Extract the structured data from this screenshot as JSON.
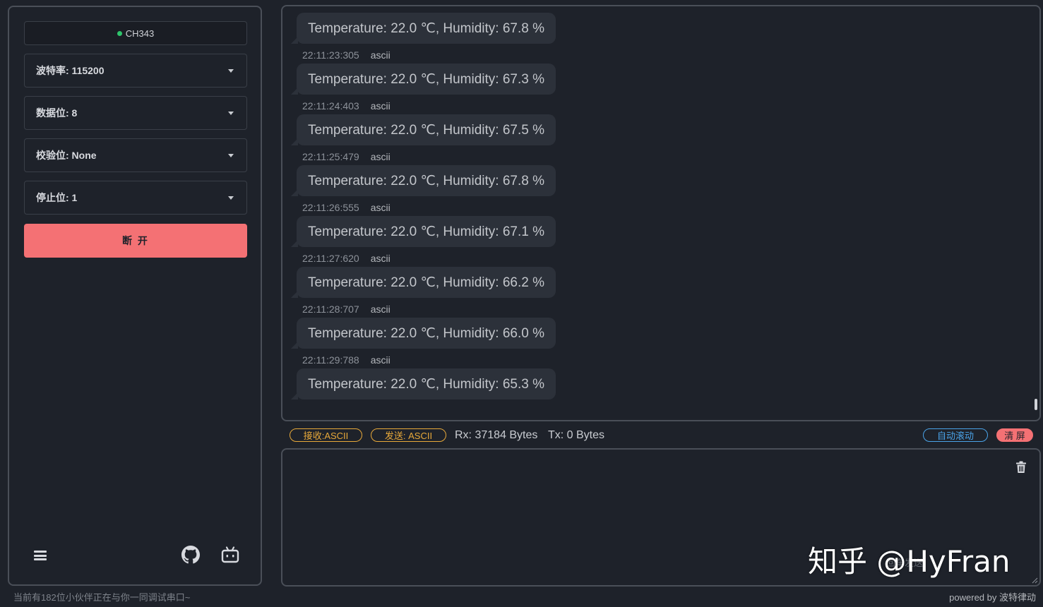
{
  "sidebar": {
    "port_name": "CH343",
    "port_status_color": "#2ec46b",
    "baud_rate_label": "波特率: 115200",
    "data_bits_label": "数据位: 8",
    "parity_label": "校验位: None",
    "stop_bits_label": "停止位: 1",
    "disconnect_label": "断 开",
    "icons": [
      "menu-icon",
      "github-icon",
      "bilibili-icon"
    ]
  },
  "messages": [
    {
      "time": "",
      "format": "",
      "text": "Temperature: 22.0 ℃, Humidity: 67.8 %"
    },
    {
      "time": "22:11:23:305",
      "format": "ascii",
      "text": "Temperature: 22.0 ℃, Humidity: 67.3 %"
    },
    {
      "time": "22:11:24:403",
      "format": "ascii",
      "text": "Temperature: 22.0 ℃, Humidity: 67.5 %"
    },
    {
      "time": "22:11:25:479",
      "format": "ascii",
      "text": "Temperature: 22.0 ℃, Humidity: 67.8 %"
    },
    {
      "time": "22:11:26:555",
      "format": "ascii",
      "text": "Temperature: 22.0 ℃, Humidity: 67.1 %"
    },
    {
      "time": "22:11:27:620",
      "format": "ascii",
      "text": "Temperature: 22.0 ℃, Humidity: 66.2 %"
    },
    {
      "time": "22:11:28:707",
      "format": "ascii",
      "text": "Temperature: 22.0 ℃, Humidity: 66.0 %"
    },
    {
      "time": "22:11:29:788",
      "format": "ascii",
      "text": "Temperature: 22.0 ℃, Humidity: 65.3 %"
    }
  ],
  "status": {
    "recv_mode": "接收:ASCII",
    "send_mode": "发送: ASCII",
    "rx": "Rx: 37184 Bytes",
    "tx": "Tx: 0 Bytes",
    "auto_scroll": "自动滚动",
    "clear": "清 屏"
  },
  "send": {
    "hint": "回车发送"
  },
  "watermark": "知乎 @HyFran",
  "footer": {
    "online": "当前有182位小伙伴正在与你一同调试串口~",
    "powered": "powered by 波特律动"
  },
  "colors": {
    "accent_red": "#f47174",
    "accent_orange": "#e8a93a",
    "accent_blue": "#4aa3e8"
  }
}
